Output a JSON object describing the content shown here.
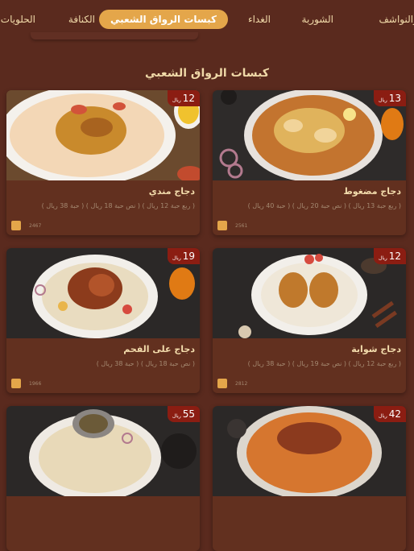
{
  "nav": {
    "tabs": [
      {
        "label": "ت والنواشف"
      },
      {
        "label": "الشوربة"
      },
      {
        "label": "الغداء"
      },
      {
        "label": "كبسات الرواق الشعبي"
      },
      {
        "label": "الكنافة"
      },
      {
        "label": "الحلويات"
      }
    ]
  },
  "section": {
    "title": "كبسات الرواق الشعبي"
  },
  "currency": "ريال",
  "items": [
    {
      "name": "دجاج مضغوط",
      "price": "13",
      "desc": "( ربع حبة 13 ريال ) ( نص حبة 20 ريال ) ( حبة 40 ريال )",
      "count": "2561"
    },
    {
      "name": "دجاج مندي",
      "price": "12",
      "desc": "( ربع حبة 12 ريال ) ( نص حبة 18 ريال ) ( حبة 38 ريال )",
      "count": "2467"
    },
    {
      "name": "دجاج شواية",
      "price": "12",
      "desc": "( ربع حبة 12 ريال ) ( نص حبة 19 ريال ) ( حبة 38 ريال )",
      "count": "2812"
    },
    {
      "name": "دجاج على الفحم",
      "price": "19",
      "desc": "( نص حبة 18 ريال ) ( حبة 38 ريال )",
      "count": "1966"
    },
    {
      "name": "",
      "price": "42",
      "desc": "",
      "count": ""
    },
    {
      "name": "",
      "price": "55",
      "desc": "",
      "count": ""
    }
  ]
}
